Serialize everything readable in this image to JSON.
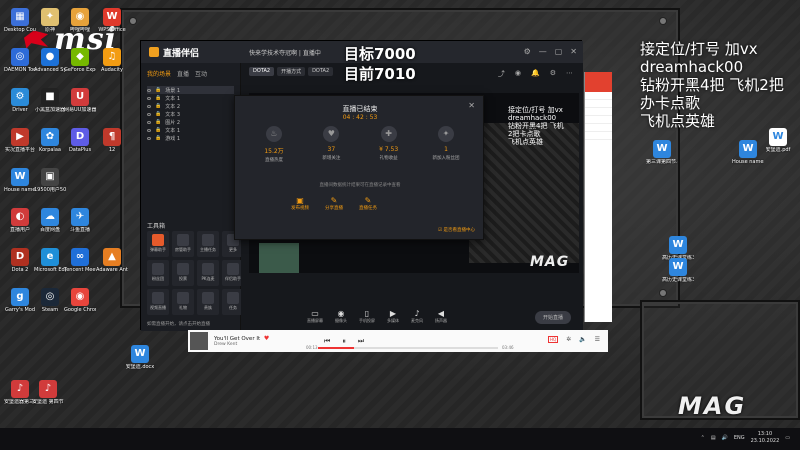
{
  "desktop": {
    "brand": "msi",
    "icons": [
      {
        "label": "Desktop Countdo...",
        "color": "#3b6fd8",
        "glyph": "▦"
      },
      {
        "label": "原神",
        "color": "#e0c070",
        "glyph": "✦"
      },
      {
        "label": "哔哩哔哩",
        "color": "#e7a23a",
        "glyph": "◉"
      },
      {
        "label": "WPS Office",
        "color": "#e0392b",
        "glyph": "W"
      },
      {
        "label": "DAEMON Tools Lite",
        "color": "#2d6bd8",
        "glyph": "◎"
      },
      {
        "label": "Advanced SystemCare",
        "color": "#1c71d8",
        "glyph": "●"
      },
      {
        "label": "GeForce Experience",
        "color": "#76b900",
        "glyph": "◆"
      },
      {
        "label": "Audacity",
        "color": "#f39c12",
        "glyph": "♫"
      },
      {
        "label": "Driver",
        "color": "#2a8bd8",
        "glyph": "⚙"
      },
      {
        "label": "小黑盒加速器",
        "color": "#222222",
        "glyph": "■"
      },
      {
        "label": "网易UU加速器",
        "color": "#d13b3b",
        "glyph": "U"
      },
      {
        "label": "实况直播平台",
        "color": "#c0392b",
        "glyph": "▶"
      },
      {
        "label": "Korpalaa",
        "color": "#2e86de",
        "glyph": "✿"
      },
      {
        "label": "DataPlus",
        "color": "#5e5ce6",
        "glyph": "D"
      },
      {
        "label": "12",
        "color": "#c0392b",
        "glyph": "¶"
      },
      {
        "label": "House names",
        "color": "#2e86de",
        "glyph": "W"
      },
      {
        "label": "19500用户5006857",
        "color": "#444444",
        "glyph": "▣"
      },
      {
        "label": "直播用户",
        "color": "#d13b3b",
        "glyph": "◐"
      },
      {
        "label": "百度网盘",
        "color": "#2e86de",
        "glyph": "☁"
      },
      {
        "label": "斗鱼直播",
        "color": "#2e86de",
        "glyph": "✈"
      },
      {
        "label": "Dota 2",
        "color": "#b03020",
        "glyph": "D"
      },
      {
        "label": "Microsoft Edge",
        "color": "#1f8fd8",
        "glyph": "e"
      },
      {
        "label": "Tencent Meeting",
        "color": "#1f6fd8",
        "glyph": "∞"
      },
      {
        "label": "Adaware Antivirus",
        "color": "#e67e22",
        "glyph": "▲"
      },
      {
        "label": "Garry's Mod",
        "color": "#2e86de",
        "glyph": "g"
      },
      {
        "label": "Steam",
        "color": "#1b2838",
        "glyph": "◎"
      },
      {
        "label": "Google Chrome",
        "color": "#e8453c",
        "glyph": "◉"
      },
      {
        "label": "安堡遗.docx",
        "color": "#2e86de",
        "glyph": "W"
      },
      {
        "label": "安堡遗器第三课.mp3",
        "color": "#d13b3b",
        "glyph": "♪"
      },
      {
        "label": "安堡遗 第四节.mp3",
        "color": "#d13b3b",
        "glyph": "♪"
      }
    ],
    "right_icons": [
      {
        "label": "安堡遗.pdf",
        "color": "#ffffff",
        "glyph": "W"
      },
      {
        "label": "第三课第四节.docx",
        "color": "#2e86de",
        "glyph": "W"
      },
      {
        "label": "House names",
        "color": "#2e86de",
        "glyph": "W"
      },
      {
        "label": "高历史课堂练习.docx",
        "color": "#2e86de",
        "glyph": "W"
      },
      {
        "label": "高历史课堂练习.docx",
        "color": "#2e86de",
        "glyph": "W"
      }
    ]
  },
  "overlay_right": [
    "接定位/打号 加vx",
    "dreamhack00",
    "钻粉开黑4把 飞机2把",
    "办卡点歌",
    "飞机点英雄"
  ],
  "overlay_target": [
    "目标7000",
    "目前7010"
  ],
  "stream_app": {
    "app_name": "直播伴侣",
    "stream_title": "快来学技术夺冠啊 | 直播中",
    "sidebar_tabs": [
      "我的场景",
      "直播",
      "互动"
    ],
    "sources": [
      "场景 1",
      "文本 1",
      "文本 2",
      "文本 3",
      "图片 2",
      "文本 1",
      "游戏 1"
    ],
    "tools_header": "工具箱",
    "tools": [
      {
        "label": "弹幕助手",
        "color": "#e55a2b"
      },
      {
        "label": "房管助手",
        "color": "#3a3c44"
      },
      {
        "label": "主播任务",
        "color": "#3a3c44"
      },
      {
        "label": "更多",
        "color": "#3a3c44"
      },
      {
        "label": "粉丝团",
        "color": "#3a3c44"
      },
      {
        "label": "投票",
        "color": "#3a3c44"
      },
      {
        "label": "PK连麦",
        "color": "#3a3c44"
      },
      {
        "label": "伴侣助手",
        "color": "#3a3c44"
      },
      {
        "label": "视频直播",
        "color": "#3a3c44"
      },
      {
        "label": "礼物",
        "color": "#3a3c44"
      },
      {
        "label": "贵族",
        "color": "#3a3c44"
      },
      {
        "label": "任务",
        "color": "#3a3c44"
      }
    ],
    "bottom_notice": "如需直播开始，请点击开始直播",
    "main_tabs": [
      "DOTA2",
      "开播方式",
      "DOTA2"
    ],
    "bottom_bar": [
      {
        "glyph": "▭",
        "label": "直播屏幕"
      },
      {
        "glyph": "◉",
        "label": "摄像头"
      },
      {
        "glyph": "▯",
        "label": "手机投屏"
      },
      {
        "glyph": "▶",
        "label": "多媒体"
      },
      {
        "glyph": "♪",
        "label": "麦克风"
      },
      {
        "glyph": "◀",
        "label": "扬声器"
      }
    ],
    "start_button": "开始直播"
  },
  "end_dialog": {
    "title": "直播已结束",
    "duration": "04 : 42 : 53",
    "stats": [
      {
        "value": "15.2万",
        "label": "直播热度",
        "glyph": "♨"
      },
      {
        "value": "37",
        "label": "新增关注",
        "glyph": "♥"
      },
      {
        "value": "¥ 7.53",
        "label": "礼物收益",
        "glyph": "✚"
      },
      {
        "value": "1",
        "label": "新加入粉丝团",
        "glyph": "✦"
      }
    ],
    "sub": "直播间数据统计结果可在直播记录中查看",
    "actions": [
      {
        "glyph": "▣",
        "label": "发布视频"
      },
      {
        "glyph": "✎",
        "label": "分享直播"
      },
      {
        "glyph": "✎",
        "label": "直播任务"
      }
    ],
    "check_label": "是否看直播中心"
  },
  "chat_overlay": [
    "接定位/打号 加vx",
    "dreamhack00",
    "钻粉开黑4把 飞机",
    "2把卡点歌",
    "飞机点英雄"
  ],
  "preview_brand": "MAG",
  "wallpaper_brand": "MAG",
  "music": {
    "song": "You'll Get Over It",
    "artist": "Drew Kent",
    "time_current": "00:13",
    "time_total": "03:46",
    "progress": 0.2,
    "quality": "HQ"
  },
  "taskbar": {
    "lang": "ENG",
    "time": "13:10",
    "date": "23.10.2022"
  }
}
